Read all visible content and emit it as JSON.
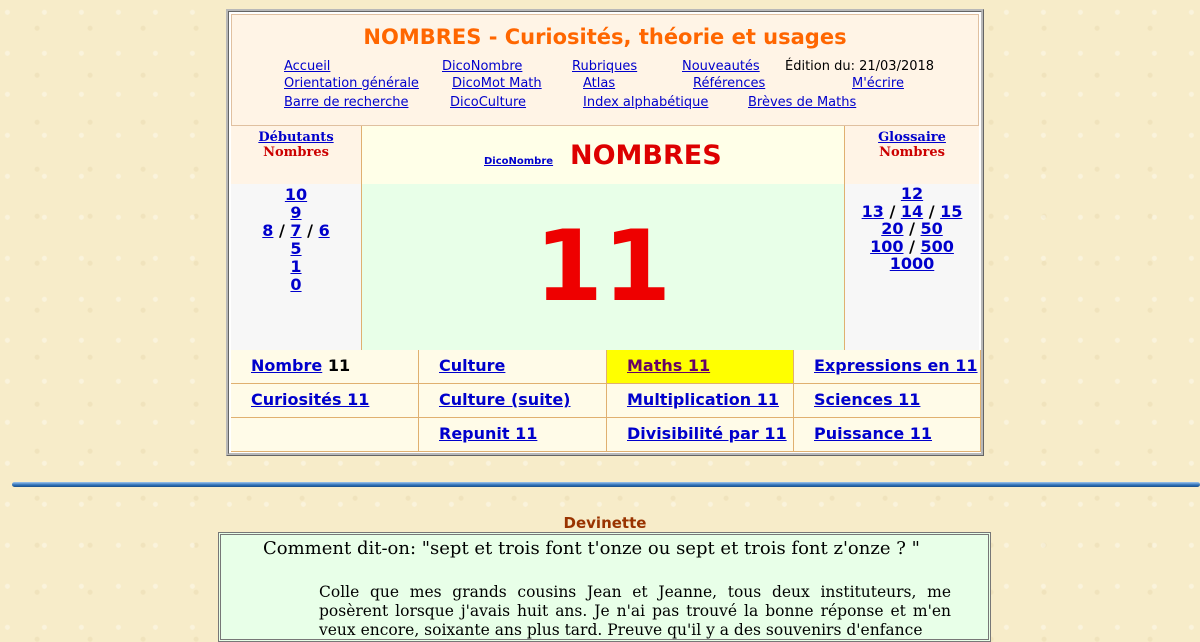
{
  "header": {
    "title": "NOMBRES - Curiosités, théorie et usages",
    "edition": "Édition du: 21/03/2018",
    "nav": [
      "Accueil",
      "DicoNombre",
      "Rubriques",
      "Nouveautés",
      "Orientation générale",
      "DicoMot Math",
      "Atlas",
      "Références",
      "M'écrire",
      "Barre de recherche",
      "DicoCulture",
      "Index alphabétique",
      "Brèves de Maths"
    ]
  },
  "left": {
    "line1": "Débutants",
    "line2": "Nombres",
    "n10": "10",
    "n9": "9",
    "n8": "8",
    "sep1": "/",
    "n7": "7",
    "sep2": "/",
    "n6": "6",
    "n5": "5",
    "n1": "1",
    "n0": "0"
  },
  "right": {
    "line1": "Glossaire",
    "line2": "Nombres",
    "n12": "12",
    "n13": "13",
    "sep1": "/",
    "n14": "14",
    "sep2": "/",
    "n15": "15",
    "n20": "20",
    "sep3": "/",
    "n50": "50",
    "n100": "100",
    "sep4": "/",
    "n500": "500",
    "n1000": "1000"
  },
  "center": {
    "dico_link": "DicoNombre",
    "word": "NOMBRES",
    "number": "11"
  },
  "grid": {
    "nombre_label": "Nombre",
    "nombre_value": "11",
    "culture": "Culture",
    "maths": "Maths 11",
    "expressions": "Expressions en 11",
    "curiosites": "Curiosités 11",
    "culture_suite": "Culture (suite)",
    "multiplication": "Multiplication 11",
    "sciences": "Sciences 11",
    "repunit": "Repunit 11",
    "divisibilite": "Divisibilité par 11",
    "puissance": "Puissance 11"
  },
  "devinette": {
    "title": "Devinette",
    "question": "Comment dit-on: \"sept et trois font t'onze ou sept et trois font z'onze ? \"",
    "answer": "Colle que mes grands cousins Jean et Jeanne, tous deux instituteurs, me posèrent lorsque j'avais huit ans. Je n'ai pas trouvé la bonne réponse et m'en veux encore, soixante ans plus tard. Preuve qu'il y a des souvenirs d'enfance"
  },
  "colors": {
    "title_orange": "#ff6600",
    "big_red": "#ee0000",
    "link_blue": "#0000cc",
    "highlight_yellow": "#ffff00"
  }
}
